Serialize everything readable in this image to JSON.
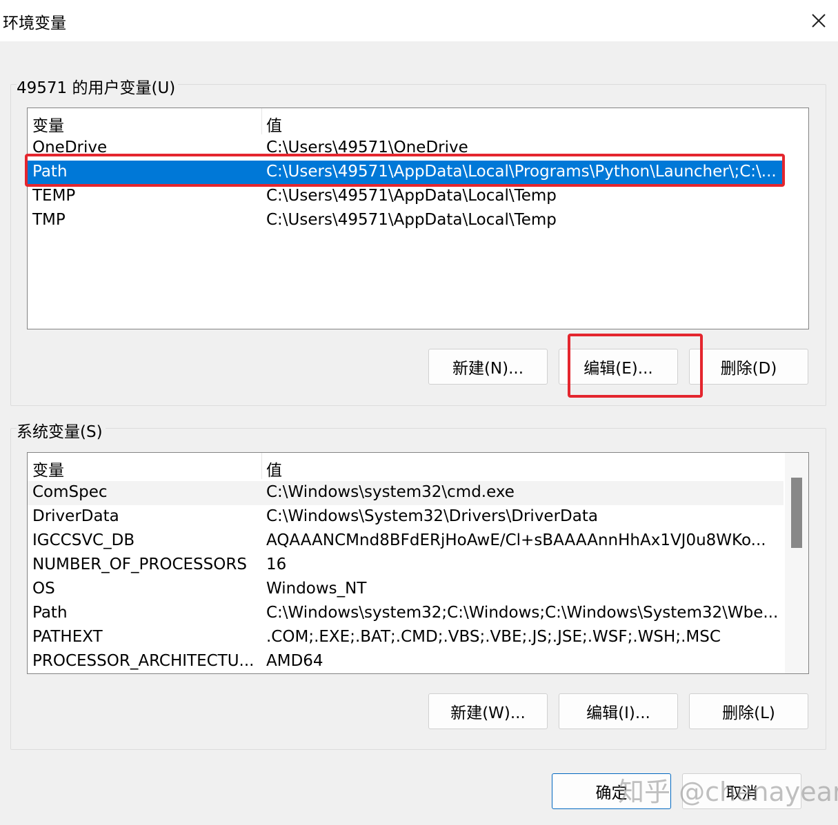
{
  "window": {
    "title": "环境变量"
  },
  "user_vars": {
    "group_label": "49571 的用户变量(U)",
    "columns": [
      "变量",
      "值"
    ],
    "rows": [
      {
        "name": "OneDrive",
        "value": "C:\\Users\\49571\\OneDrive"
      },
      {
        "name": "Path",
        "value": "C:\\Users\\49571\\AppData\\Local\\Programs\\Python\\Launcher\\;C:\\..."
      },
      {
        "name": "TEMP",
        "value": "C:\\Users\\49571\\AppData\\Local\\Temp"
      },
      {
        "name": "TMP",
        "value": "C:\\Users\\49571\\AppData\\Local\\Temp"
      }
    ],
    "buttons": {
      "new": "新建(N)...",
      "edit": "编辑(E)...",
      "delete": "删除(D)"
    }
  },
  "system_vars": {
    "group_label": "系统变量(S)",
    "columns": [
      "变量",
      "值"
    ],
    "rows": [
      {
        "name": "ComSpec",
        "value": "C:\\Windows\\system32\\cmd.exe"
      },
      {
        "name": "DriverData",
        "value": "C:\\Windows\\System32\\Drivers\\DriverData"
      },
      {
        "name": "IGCCSVC_DB",
        "value": "AQAAANCMnd8BFdERjHoAwE/Cl+sBAAAAnnHhAx1VJ0u8WKo..."
      },
      {
        "name": "NUMBER_OF_PROCESSORS",
        "value": "16"
      },
      {
        "name": "OS",
        "value": "Windows_NT"
      },
      {
        "name": "Path",
        "value": "C:\\Windows\\system32;C:\\Windows;C:\\Windows\\System32\\Wbe..."
      },
      {
        "name": "PATHEXT",
        "value": ".COM;.EXE;.BAT;.CMD;.VBS;.VBE;.JS;.JSE;.WSF;.WSH;.MSC"
      },
      {
        "name": "PROCESSOR_ARCHITECTU...",
        "value": "AMD64"
      }
    ],
    "buttons": {
      "new": "新建(W)...",
      "edit": "编辑(I)...",
      "delete": "删除(L)"
    }
  },
  "footer": {
    "ok": "确定",
    "cancel": "取消"
  },
  "watermark": "知乎 @chenayear",
  "colors": {
    "selection": "#0078d7",
    "highlight": "#e4262e",
    "primary_border": "#0067c0"
  }
}
